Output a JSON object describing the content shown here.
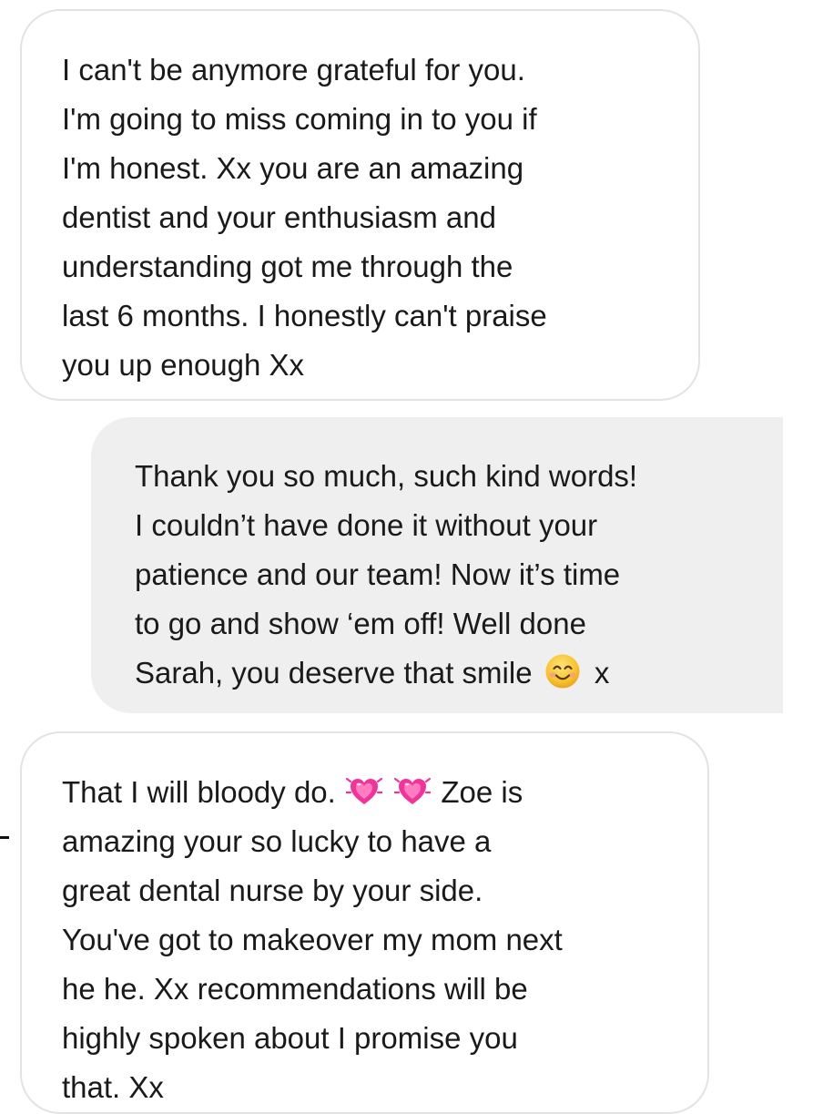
{
  "thread": {
    "messages": [
      {
        "direction": "incoming",
        "lines": [
          "I can't be anymore grateful for you.",
          "I'm going to miss coming in to you if",
          "I'm honest. Xx you are an amazing",
          "dentist and your enthusiasm and",
          "understanding got me through the",
          "last 6 months. I honestly can't praise",
          "you up enough Xx"
        ]
      },
      {
        "direction": "outgoing",
        "lines": [
          "Thank you so much, such kind words!",
          "I couldn’t have done it without your",
          "patience and our team! Now it’s time",
          "to go and show ‘em off! Well done"
        ],
        "last_line_before_emoji": "Sarah, you deserve that smile",
        "emoji": "smiling-face-emoji",
        "last_line_after_emoji": "x"
      },
      {
        "direction": "incoming",
        "first_line_before_emoji": "That I will bloody do.",
        "emojis": [
          "growing-heart-emoji",
          "growing-heart-emoji"
        ],
        "first_line_after_emoji": "Zoe is",
        "lines": [
          "amazing your so lucky to have a",
          "great dental nurse by your side.",
          "You've got to makeover my mom next",
          "he he. Xx recommendations will be",
          "highly spoken about I promise you",
          "that. Xx"
        ]
      }
    ]
  },
  "colors": {
    "incoming_bubble_bg": "#ffffff",
    "incoming_bubble_border": "#e3e3e3",
    "outgoing_bubble_bg": "#efefef",
    "text": "#1a1a1a",
    "heart_pink": "#f0359a",
    "smile_yellow": "#f7c330"
  }
}
